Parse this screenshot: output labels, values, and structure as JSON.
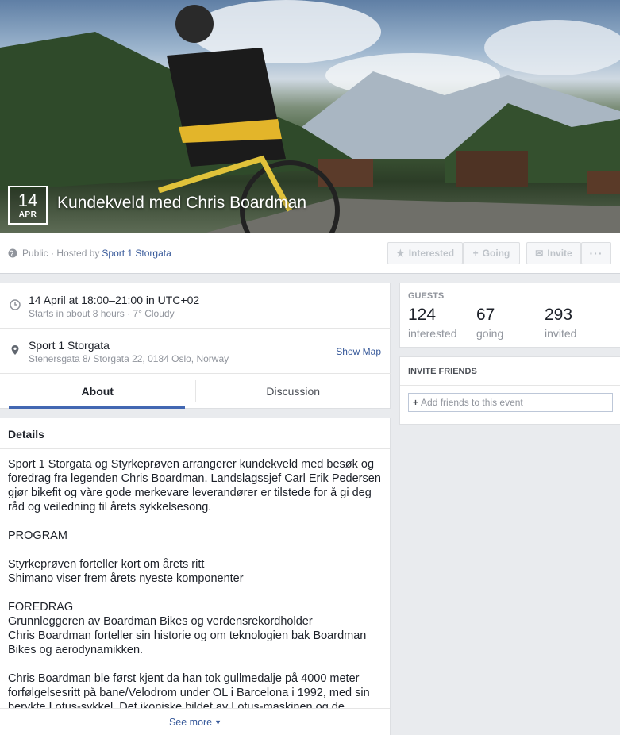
{
  "cover": {
    "date_day": "14",
    "date_month": "APR",
    "title": "Kundekveld med Chris Boardman"
  },
  "header": {
    "privacy": "Public · Hosted by",
    "host": "Sport 1 Storgata",
    "interested_label": "Interested",
    "going_label": "Going",
    "invite_label": "Invite",
    "more_label": "···"
  },
  "info": {
    "time_main": "14 April at 18:00–21:00 in UTC+02",
    "time_sub": "Starts in about 8 hours · 7° Cloudy",
    "place_main": "Sport 1 Storgata",
    "place_sub": "Stenersgata 8/ Storgata 22, 0184 Oslo, Norway",
    "show_map": "Show Map"
  },
  "tabs": {
    "about": "About",
    "discussion": "Discussion"
  },
  "details": {
    "heading": "Details",
    "paragraphs": [
      "Sport 1 Storgata og Styrkeprøven arrangerer kundekveld med besøk og foredrag fra legenden Chris Boardman. Landslagssjef Carl Erik Pedersen gjør bikefit og våre gode merkevare leverandører er tilstede for å gi deg råd og veiledning til årets sykkelsesong.",
      "PROGRAM",
      "Styrkeprøven forteller kort om årets ritt\nShimano viser frem årets nyeste komponenter",
      "FOREDRAG\nGrunnleggeren av Boardman Bikes og verdensrekordholder\nChris Boardman forteller sin historie og om teknologien bak Boardman Bikes og aerodynamikken.",
      "Chris Boardman ble først kjent da han tok gullmedalje på 4000 meter forfølgelsesritt på bane/Velodrom under OL i Barcelona i 1992, med sin berykte Lotus-sykkel. Det ikoniske bildet av Lotus-maskinen og de"
    ],
    "see_more": "See more"
  },
  "guests": {
    "label": "GUESTS",
    "interested_count": "124",
    "interested_label": "interested",
    "going_count": "67",
    "going_label": "going",
    "invited_count": "293",
    "invited_label": "invited"
  },
  "invite": {
    "heading": "INVITE FRIENDS",
    "placeholder": "Add friends to this event"
  },
  "colors": {
    "link": "#365899",
    "tab_accent": "#4267b2",
    "page_bg": "#e9ebee"
  }
}
